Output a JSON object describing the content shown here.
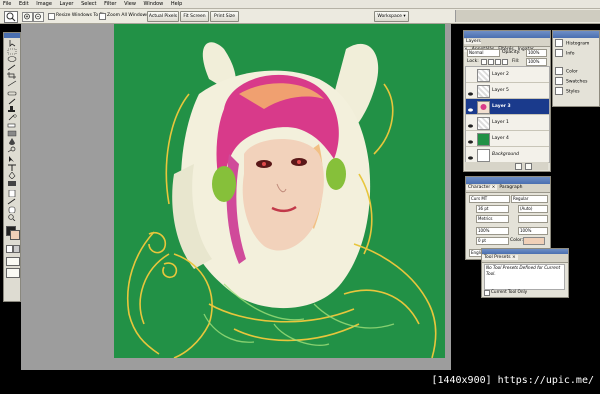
{
  "menu": [
    "File",
    "Edit",
    "Image",
    "Layer",
    "Select",
    "Filter",
    "View",
    "Window",
    "Help"
  ],
  "options": {
    "resize_label": "Resize Windows To Fit",
    "zoom_all_label": "Zoom All Windows",
    "actual_pixels": "Actual Pixels",
    "fit_screen": "Fit Screen",
    "print_size": "Print Size",
    "workspace": "Workspace ▾"
  },
  "layers_panel": {
    "tabs": [
      "Layers ×",
      "Annotálás",
      "Eltérés",
      "Ingatar"
    ],
    "blend_mode": "Normal",
    "opacity_label": "Opacity:",
    "opacity_value": "100%",
    "lock_label": "Lock:",
    "fill_label": "Fill:",
    "fill_value": "100%",
    "layers": [
      {
        "name": "Layer 2",
        "visible": false,
        "selected": false
      },
      {
        "name": "Layer 5",
        "visible": true,
        "selected": false
      },
      {
        "name": "Layer 3",
        "visible": true,
        "selected": true
      },
      {
        "name": "Layer 1",
        "visible": true,
        "selected": false
      },
      {
        "name": "Layer 4",
        "visible": true,
        "selected": false
      },
      {
        "name": "Background",
        "visible": true,
        "selected": false
      }
    ]
  },
  "side_panels": [
    {
      "name": "Histogram"
    },
    {
      "name": "Info"
    },
    {
      "name": "Color"
    },
    {
      "name": "Swatches"
    },
    {
      "name": "Styles"
    }
  ],
  "character_panel": {
    "tabs": [
      "Character ×",
      "Paragraph"
    ],
    "font": "Curs MT",
    "style": "Regular",
    "size": "36 pt",
    "leading": "(Auto)",
    "tracking": "Metrics",
    "scale_v": "100%",
    "scale_h": "100%",
    "baseline": "0 pt",
    "color_label": "Color:",
    "language": "English: UK"
  },
  "tool_presets": {
    "tab": "Tool Presets ×",
    "message": "No Tool Presets Defined for Current Tool.",
    "current_only": "Current Tool Only"
  },
  "colors": {
    "canvas_bg": "#229146",
    "selected_layer": "#1a3a8c",
    "foreground_swatch": "#f0d0b8"
  },
  "watermark": "[1440x900] https://upic.me/"
}
